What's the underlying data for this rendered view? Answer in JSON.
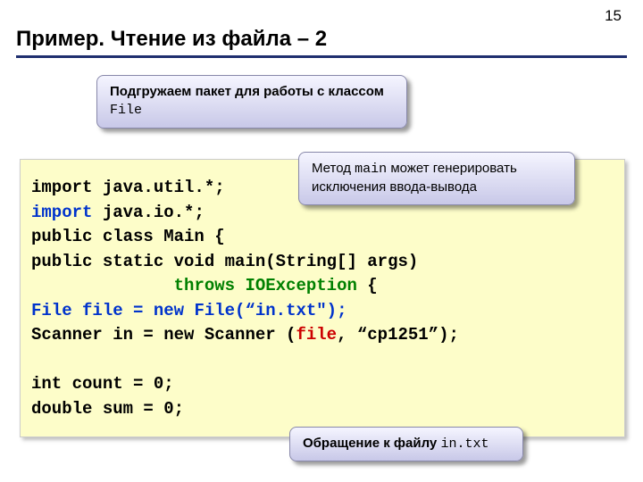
{
  "page_number": "15",
  "title": "Пример. Чтение из файла – 2",
  "callout1": {
    "line1": "Подгружаем пакет для работы с классом",
    "mono": "File"
  },
  "callout2": {
    "prefix": "Метод ",
    "mono": "main",
    "suffix": " может генерировать исключения ввода-вывода"
  },
  "callout3": {
    "prefix": "Обращение к файлу ",
    "mono": "in.txt"
  },
  "code": {
    "l1a": "import java.util.*;",
    "l2kw": "import",
    "l2b": " java.io.*;",
    "l3": "public class Main {",
    "l4": "public static void main(String[] args)",
    "l5pad": "              ",
    "l5kw": "throws IOException",
    "l5end": " {",
    "l6a": "File file = ",
    "l6kw": "new",
    "l6b": " File(“in.txt\");",
    "l7a": "Scanner in = new Scanner (",
    "l7red": "file",
    "l7b": ", “cp1251”);",
    "blank": "",
    "l8": "int count = 0;",
    "l9": "double sum = 0;"
  }
}
